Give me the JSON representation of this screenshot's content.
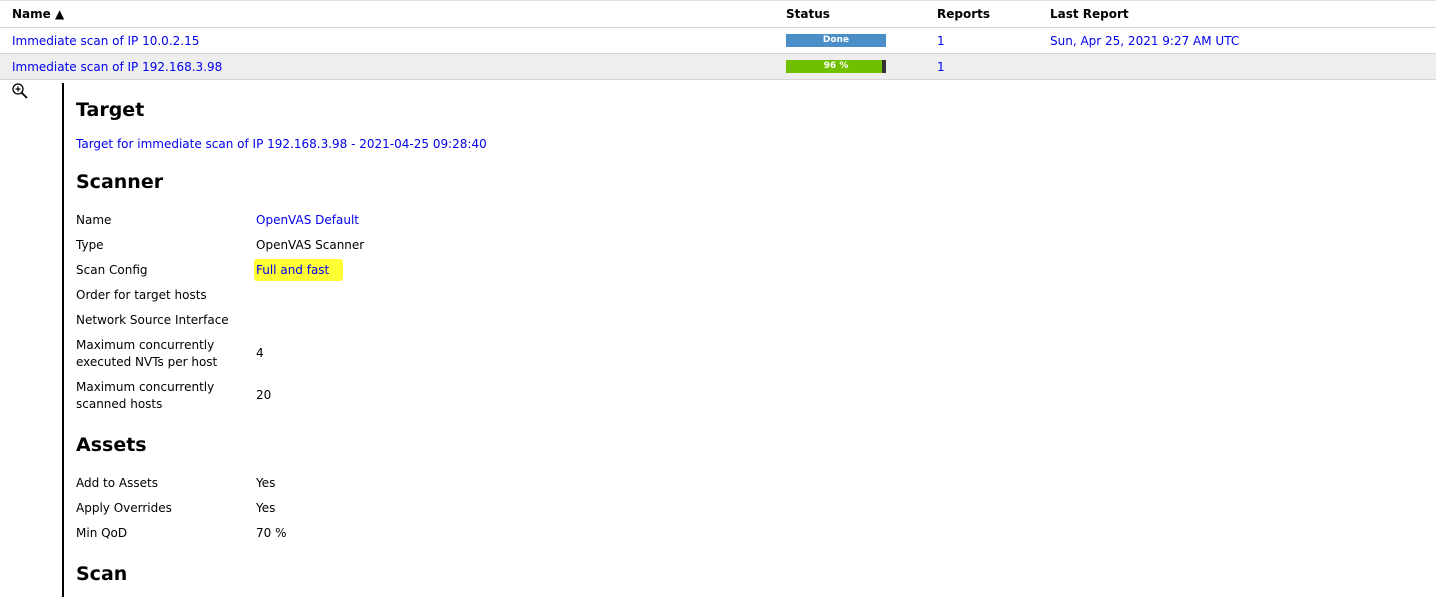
{
  "table": {
    "headers": {
      "name": "Name ▲",
      "status": "Status",
      "reports": "Reports",
      "last_report": "Last Report"
    },
    "rows": [
      {
        "name": "Immediate scan of IP 10.0.2.15",
        "status_label": "Done",
        "progress": 1.0,
        "reports": "1",
        "last_report": "Sun, Apr 25, 2021 9:27 AM UTC"
      },
      {
        "name": "Immediate scan of IP 192.168.3.98",
        "status_label": "96 %",
        "progress": 0.96,
        "reports": "1",
        "last_report": ""
      }
    ]
  },
  "details": {
    "zoom_icon": "zoom-in-icon",
    "target": {
      "heading": "Target",
      "link": "Target for immediate scan of IP 192.168.3.98 - 2021-04-25 09:28:40"
    },
    "scanner": {
      "heading": "Scanner",
      "rows": [
        {
          "label": "Name",
          "value": "OpenVAS Default"
        },
        {
          "label": "Type",
          "value": "OpenVAS Scanner"
        },
        {
          "label": "Scan Config",
          "value": "Full and fast"
        },
        {
          "label": "Order for target hosts",
          "value": ""
        },
        {
          "label": "Network Source Interface",
          "value": ""
        },
        {
          "label": "Maximum concurrently executed NVTs per host",
          "value": "4"
        },
        {
          "label": "Maximum concurrently scanned hosts",
          "value": "20"
        }
      ]
    },
    "assets": {
      "heading": "Assets",
      "rows": [
        {
          "label": "Add to Assets",
          "value": "Yes"
        },
        {
          "label": "Apply Overrides",
          "value": "Yes"
        },
        {
          "label": "Min QoD",
          "value": "70 %"
        }
      ]
    },
    "scan": {
      "heading": "Scan"
    }
  },
  "colors": {
    "link": "#0000ee",
    "done_bar": "#4c8ec7",
    "running_bar": "#70c000",
    "highlight": "#ffff33",
    "row_alt": "#eeeeee"
  }
}
